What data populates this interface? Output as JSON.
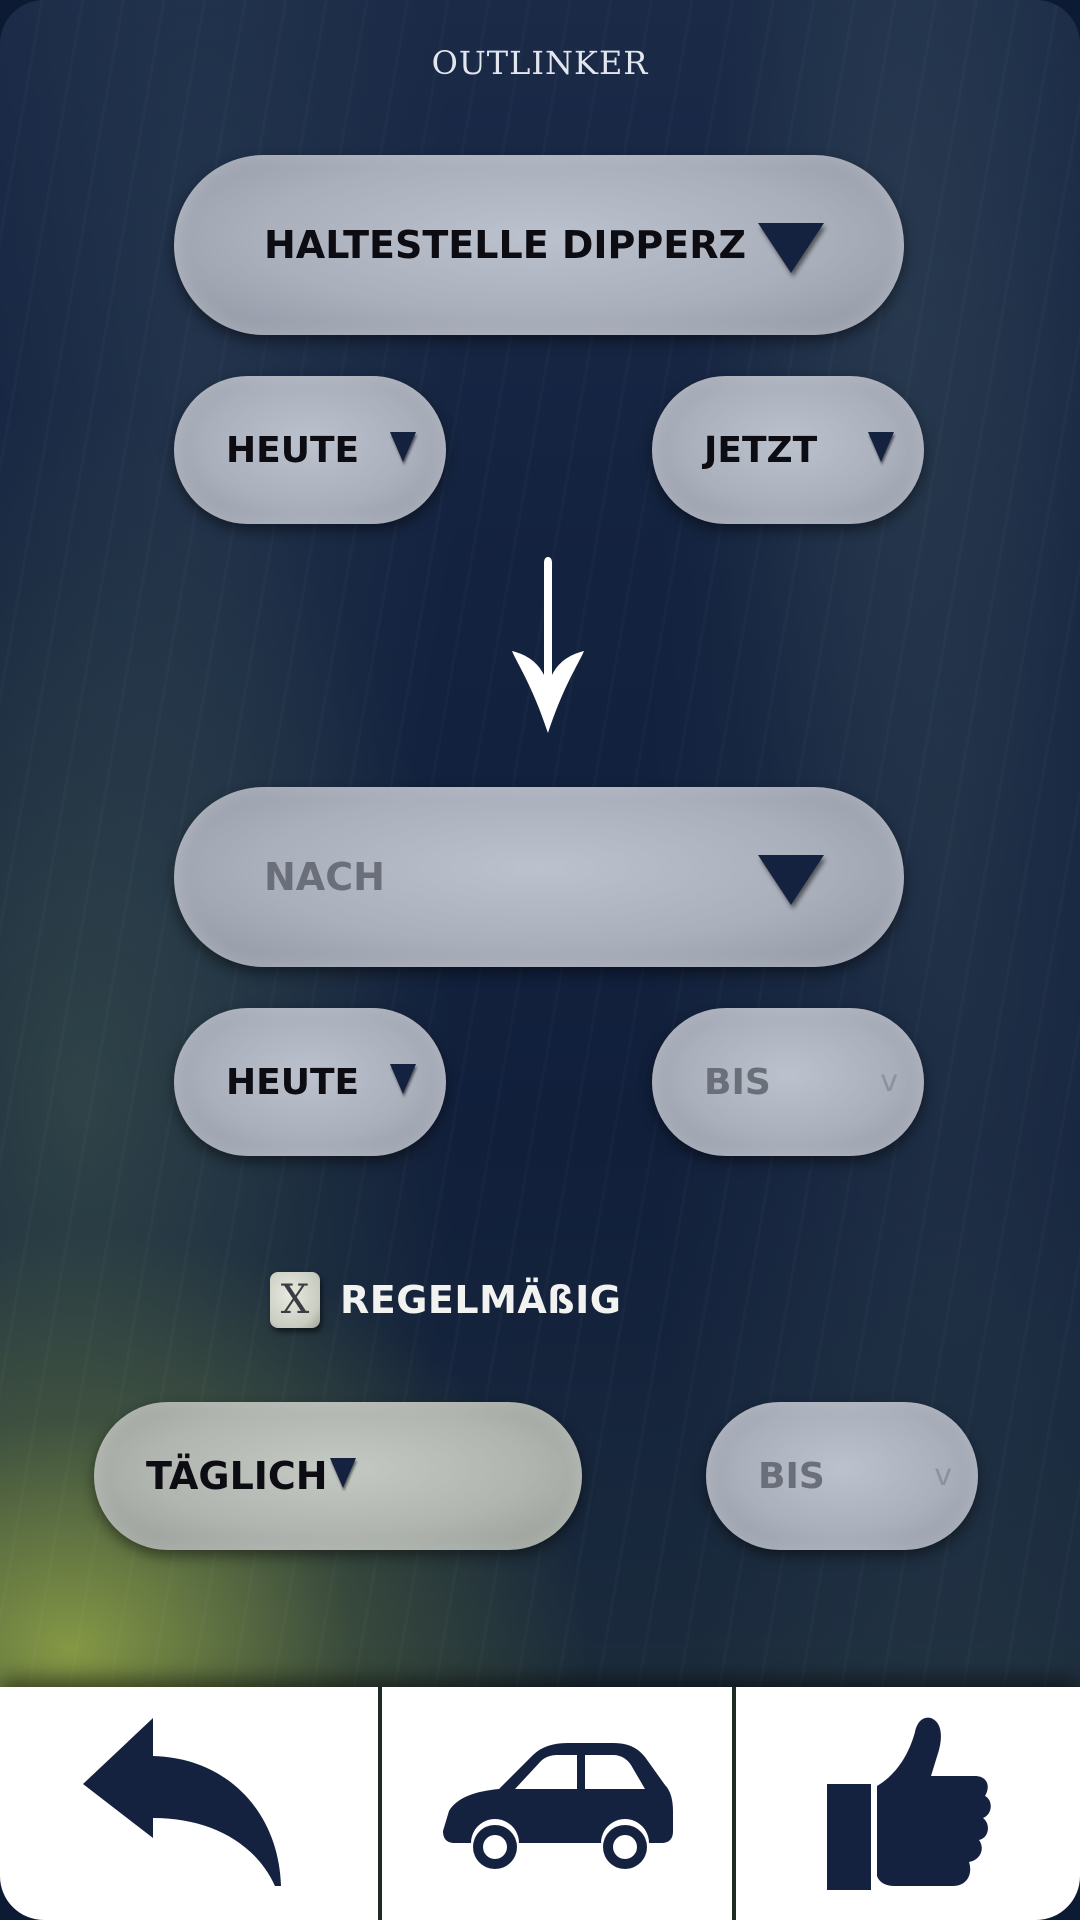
{
  "app": {
    "title": "OUTLINKER"
  },
  "from": {
    "station": "HALTESTELLE DIPPERZ",
    "date": "HEUTE",
    "time": "JETZT"
  },
  "to": {
    "station_placeholder": "NACH",
    "date": "HEUTE",
    "until_placeholder": "BIS"
  },
  "recurring": {
    "checkbox_mark": "X",
    "label": "REGELMÄßIG",
    "frequency": "TÄGLICH",
    "until_placeholder": "BIS"
  },
  "bottom_bar": {
    "buttons": [
      "back-arrow-icon",
      "car-icon",
      "thumbs-up-icon"
    ]
  },
  "colors": {
    "icon": "#15223f",
    "pill": "#a9afbb",
    "bar_background": "#ffffff"
  }
}
